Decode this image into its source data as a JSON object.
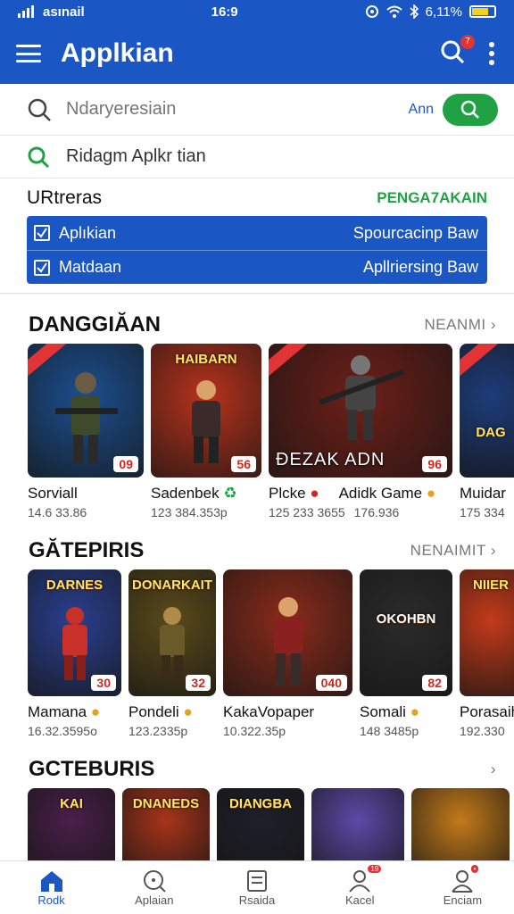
{
  "status": {
    "carrier": "asınail",
    "time": "16:9",
    "battery": "6,11%",
    "battery_level": 0.68
  },
  "appbar": {
    "title": "Applkian",
    "notif_count": "7"
  },
  "search": {
    "placeholder": "Ndaryeresiain",
    "aux": "Ann"
  },
  "suggestion": {
    "text": "Ridagm Aplkr tian"
  },
  "filters": {
    "title": "URtreras",
    "action": "PENGA7AKAIN",
    "items": [
      {
        "label": "Aplıkian",
        "value": "Spourcacinp Baw"
      },
      {
        "label": "Matdaan",
        "value": "Apllriersing Baw"
      }
    ]
  },
  "sections": [
    {
      "title": "DANGGIĂAN",
      "more": "NEANMI",
      "cards": [
        {
          "name": "Sorviall",
          "meta": "14.6 33.86",
          "rating": "09",
          "thumb_title": "",
          "bg": "#1b4f8f"
        },
        {
          "name": "Sadenbek",
          "meta": "123 384.353p",
          "rating": "56",
          "thumb_title": "HAIBARN",
          "bg": "#b8321c"
        },
        {
          "name": "Plcke",
          "meta": "125 233 3655",
          "rating": "96",
          "thumb_title": "",
          "bg": "#6e1f18",
          "overlay": "ĐEZAK ADN"
        },
        {
          "name": "Adidk Game",
          "meta": "176.936",
          "rating": "",
          "thumb_title": "",
          "bg": "#2a1a3a"
        },
        {
          "name": "Muidar",
          "meta": "175 334",
          "rating": "",
          "thumb_title": "DAG",
          "bg": "#1d3c7a"
        }
      ]
    },
    {
      "title": "GĂTEPIRIS",
      "more": "NENAIMIT",
      "cards": [
        {
          "name": "Mamana",
          "meta": "16.32.3595o",
          "rating": "30",
          "thumb_title": "DARNES",
          "bg": "#2a3f8f"
        },
        {
          "name": "Pondeli",
          "meta": "123.2335p",
          "rating": "32",
          "thumb_title": "DONARKAIT",
          "bg": "#5a4a1a"
        },
        {
          "name": "KakaVopaper",
          "meta": "10.322.35p",
          "rating": "040",
          "thumb_title": "",
          "bg": "#8a2b1a"
        },
        {
          "name": "Somali",
          "meta": "148 3485p",
          "rating": "82",
          "thumb_title": "OKOHBN",
          "bg": "#2b2b2b"
        },
        {
          "name": "Porasaih",
          "meta": "192.330",
          "rating": "",
          "thumb_title": "NIIER",
          "bg": "#c43a1a"
        }
      ]
    },
    {
      "title": "GCTEBURIS",
      "more": "",
      "cards": [
        {
          "name": "",
          "meta": "",
          "rating": "",
          "thumb_title": "KAI",
          "bg": "#4a1f4a"
        },
        {
          "name": "",
          "meta": "",
          "rating": "",
          "thumb_title": "DNANEDS",
          "bg": "#a8341a"
        },
        {
          "name": "",
          "meta": "",
          "rating": "",
          "thumb_title": "DIANGBA",
          "bg": "#1f1f2a"
        },
        {
          "name": "",
          "meta": "",
          "rating": "",
          "thumb_title": "",
          "bg": "#5b4aa8"
        },
        {
          "name": "",
          "meta": "",
          "rating": "",
          "thumb_title": "",
          "bg": "#c47a1a"
        }
      ]
    }
  ],
  "bottom_nav": [
    {
      "label": "Rodk",
      "icon": "home-icon",
      "active": true
    },
    {
      "label": "Aplaian",
      "icon": "search-icon",
      "active": false
    },
    {
      "label": "Rsaida",
      "icon": "list-icon",
      "active": false
    },
    {
      "label": "Kacel",
      "icon": "user-icon",
      "active": false,
      "badge": "19"
    },
    {
      "label": "Enciam",
      "icon": "profile-icon",
      "active": false,
      "badge": "•"
    }
  ],
  "colors": {
    "primary": "#1a56c4",
    "accent_green": "#20a244",
    "rating_red": "#d3261d"
  }
}
